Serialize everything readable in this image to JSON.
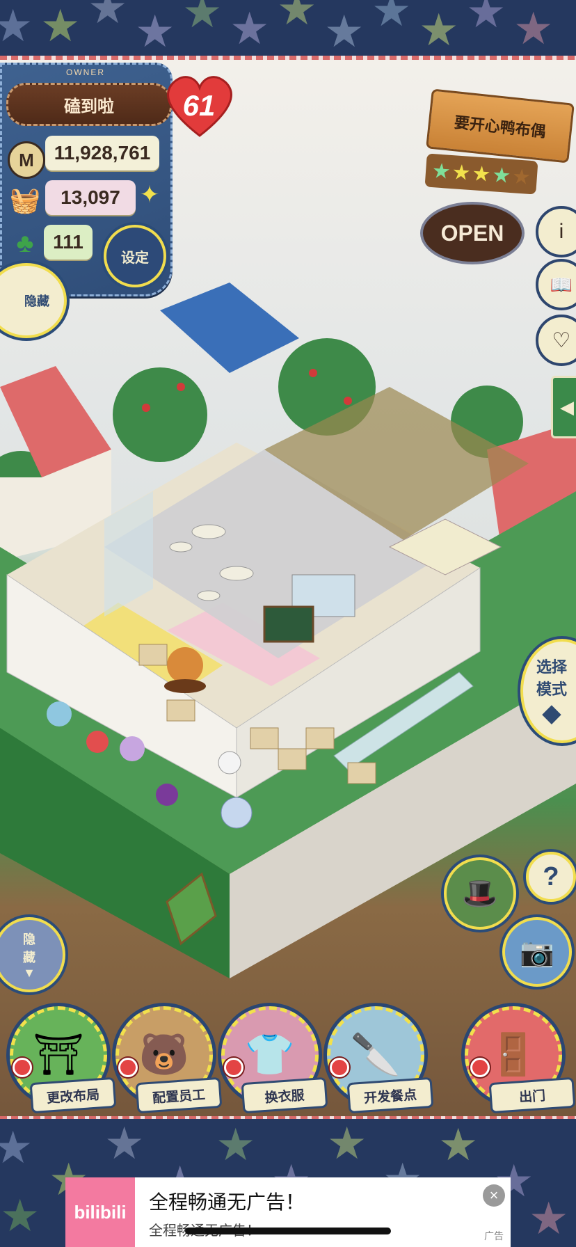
{
  "owner": {
    "tag": "OWNER",
    "name": "磕到啦",
    "hearts": "61"
  },
  "stats": {
    "money": "11,928,761",
    "ingredients": "13,097",
    "clovers": "111"
  },
  "buttons": {
    "settings": "设定",
    "hide_top": "隐藏",
    "hide_bottom": "隐藏",
    "select_mode": "选择模式"
  },
  "shop": {
    "name": "要开心鸭布偶",
    "rating_stars": 4,
    "status": "OPEN"
  },
  "side": {
    "info": "i",
    "book": "📖",
    "chat": "♡",
    "help": "?"
  },
  "toolbar": [
    {
      "label": "更改布局"
    },
    {
      "label": "配置员工"
    },
    {
      "label": "换衣服"
    },
    {
      "label": "开发餐点"
    },
    {
      "label": "出门"
    }
  ],
  "ad": {
    "logo": "bilibili",
    "title": "全程畅通无广告！",
    "subtitle": "全程畅通无广告！",
    "tag": "广告",
    "close": "×"
  },
  "colors": {
    "border_navy": "#25385f",
    "stitch_gold": "#f2e14c",
    "heart_red": "#e23b3b",
    "ad_pink": "#f37aa0"
  }
}
